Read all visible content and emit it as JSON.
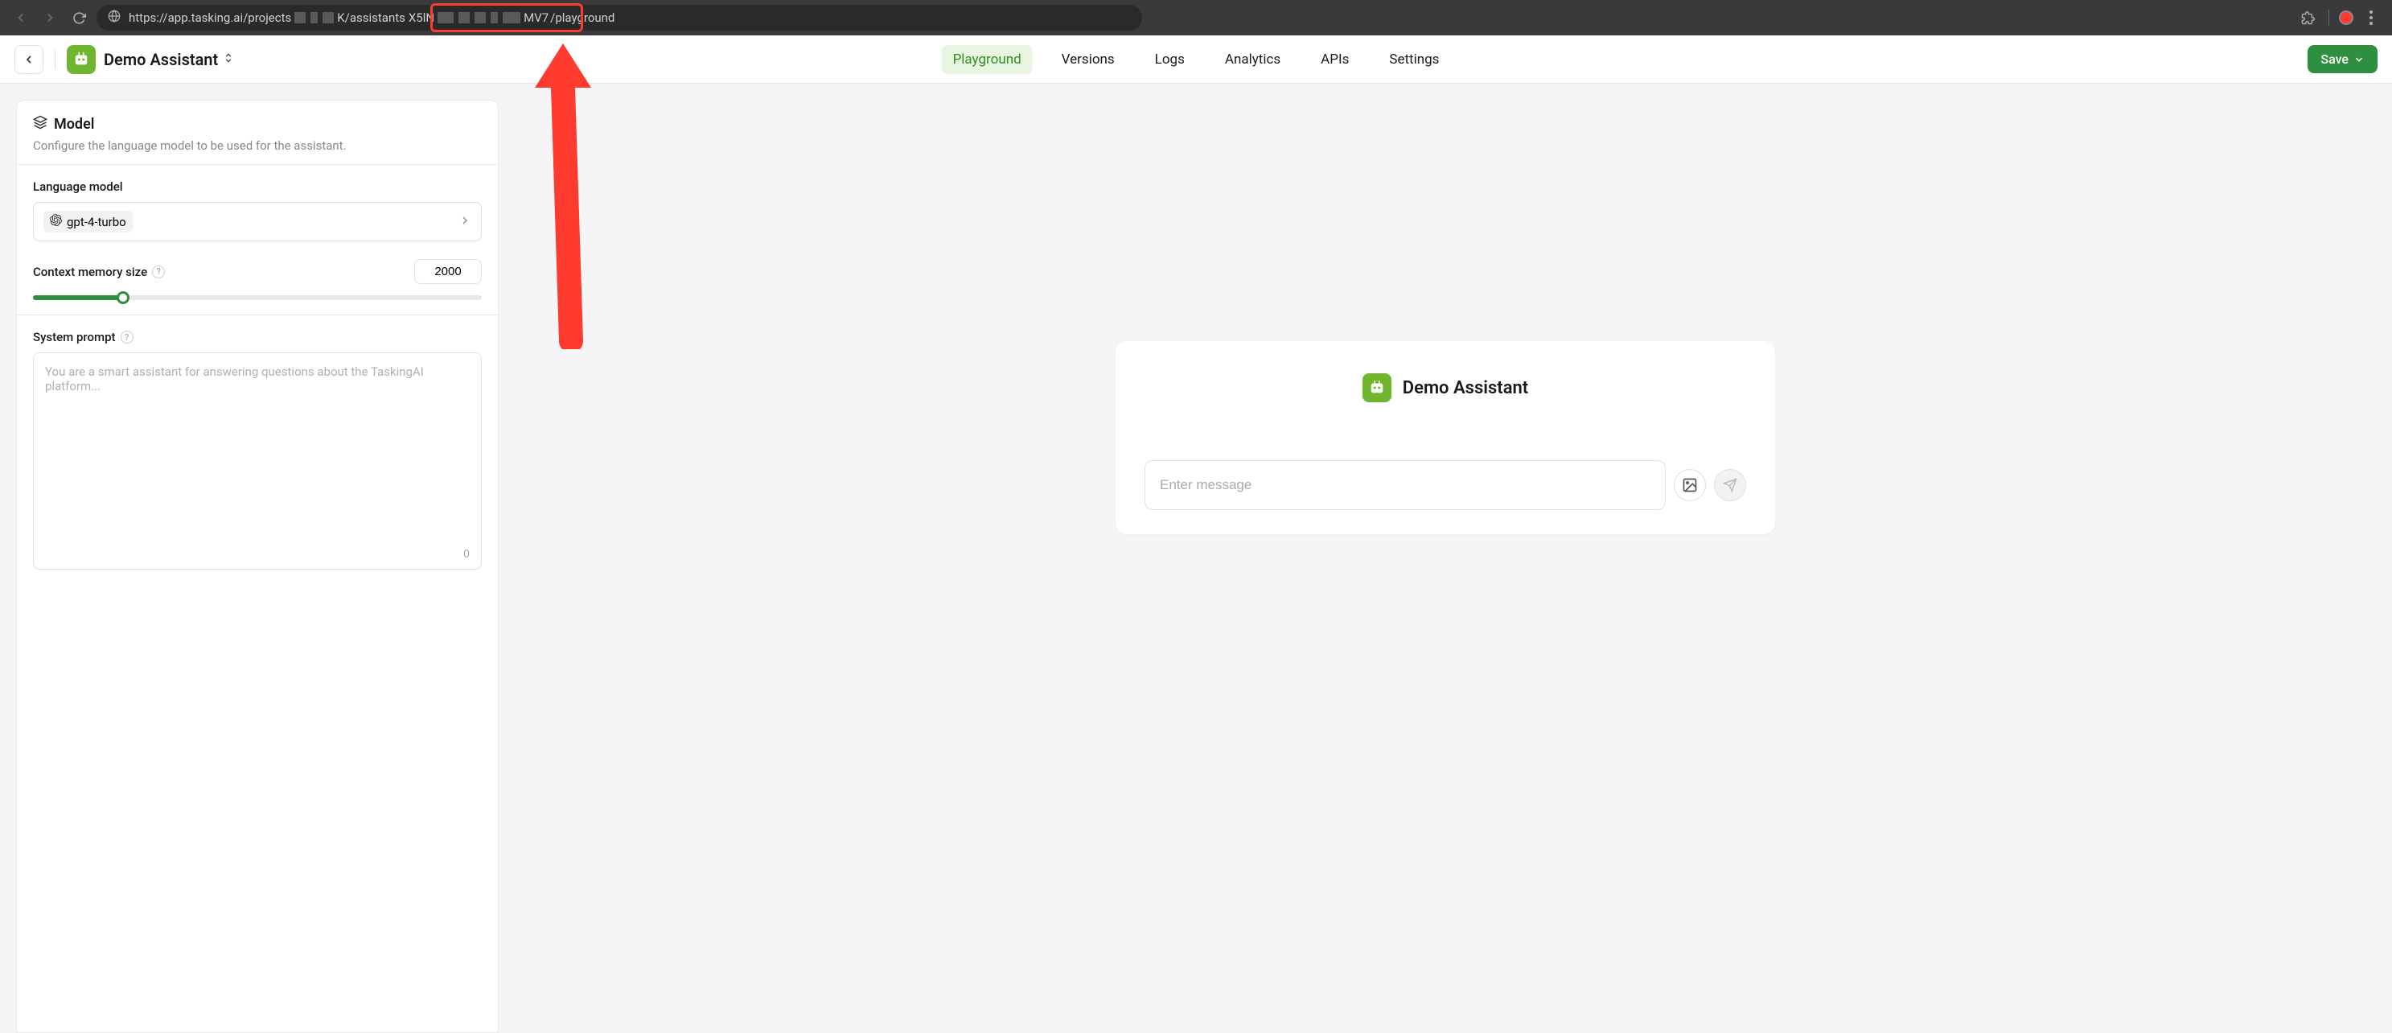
{
  "browser": {
    "url_prefix": "https://app.tasking.ai/projects",
    "url_mid1": "K/assistants",
    "url_mid2": "X5lN",
    "url_mid3": "MV7",
    "url_suffix": "/playground"
  },
  "header": {
    "title": "Demo Assistant",
    "tabs": [
      "Playground",
      "Versions",
      "Logs",
      "Analytics",
      "APIs",
      "Settings"
    ],
    "active_tab_index": 0,
    "save_label": "Save"
  },
  "model_panel": {
    "title": "Model",
    "subtitle": "Configure the language model to be used for the assistant.",
    "lang_label": "Language model",
    "model_name": "gpt-4-turbo",
    "ctx_label": "Context memory size",
    "ctx_value": "2000",
    "sys_prompt_label": "System prompt",
    "sys_prompt_placeholder": "You are a smart assistant for answering questions about the TaskingAI platform...",
    "char_count": "0"
  },
  "chat": {
    "title": "Demo Assistant",
    "input_placeholder": "Enter message"
  },
  "colors": {
    "accent_green": "#2d8f3f",
    "logo_green": "#6fb52e",
    "annotation_red": "#ff3b30"
  }
}
